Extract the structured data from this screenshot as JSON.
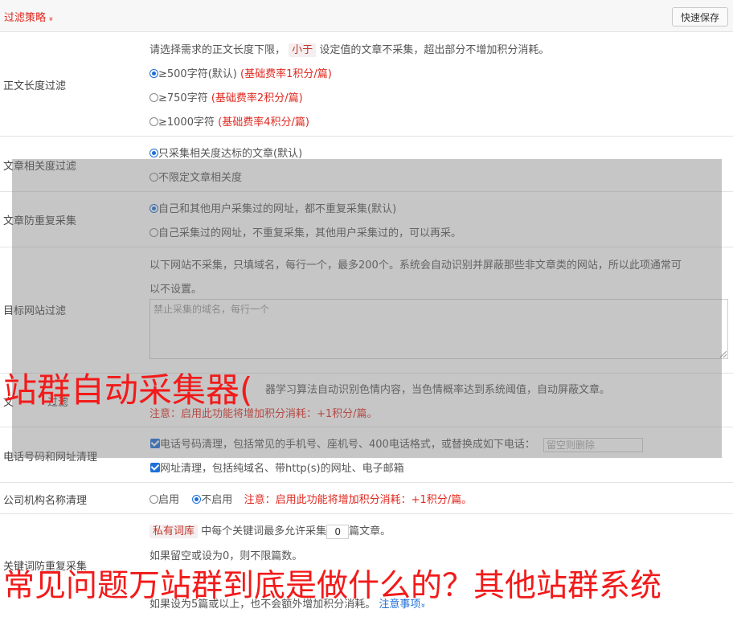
{
  "header": {
    "title": "过滤策略",
    "chevron": "»",
    "save_label": "快速保存"
  },
  "length_filter": {
    "label": "正文长度过滤",
    "desc_before": "请选择需求的正文长度下限，",
    "desc_tag": "小于",
    "desc_after": "设定值的文章不采集，超出部分不增加积分消耗。",
    "options": [
      {
        "text": "≥500字符(默认)",
        "note": "(基础费率1积分/篇)"
      },
      {
        "text": "≥750字符",
        "note": "(基础费率2积分/篇)"
      },
      {
        "text": "≥1000字符",
        "note": "(基础费率4积分/篇)"
      }
    ]
  },
  "relevance": {
    "label": "文章相关度过滤",
    "options": [
      "只采集相关度达标的文章(默认)",
      "不限定文章相关度"
    ]
  },
  "dedupe": {
    "label": "文章防重复采集",
    "options": [
      "自己和其他用户采集过的网址，都不重复采集(默认)",
      "自己采集过的网址，不重复采集，其他用户采集过的，可以再采。"
    ]
  },
  "site_filter": {
    "label": "目标网站过滤",
    "desc_line1": "以下网站不采集，只填域名，每行一个，最多200个。系统会自动识别并屏蔽那些非文章类的网站，所以此项通常可",
    "desc_line2": "以不设置。",
    "placeholder": "禁止采集的域名，每行一个"
  },
  "porn_filter": {
    "label_partial": "文",
    "label_partial2": "过滤",
    "text_partial": "器学习算法自动识别色情内容，当色情概率达到系统阈值，自动屏蔽文章。",
    "note": "注意：启用此功能将增加积分消耗：+1积分/篇。"
  },
  "phone_clean": {
    "label": "电话号码和网址清理",
    "phone_text": "电话号码清理，包括常见的手机号、座机号、400电话格式，或替换成如下电话：",
    "phone_placeholder": "留空则删除",
    "url_text": "网址清理，包括纯域名、带http(s)的网址、电子邮箱"
  },
  "org_clean": {
    "label": "公司机构名称清理",
    "enable": "启用",
    "disable": "不启用",
    "note": "注意：启用此功能将增加积分消耗：+1积分/篇。"
  },
  "keyword_dedupe": {
    "label": "关键词防重复采集",
    "tag": "私有词库",
    "line1_after": "中每个关键词最多允许采集",
    "count": "0",
    "line1_end": "篇文章。",
    "line2": "如果留空或设为0，则不限篇数。",
    "line4": "如果设为5篇或以上，也不会额外增加积分消耗。",
    "notice_link": "注意事项",
    "notice_chevron": "»"
  },
  "watermark": {
    "line1": "站群自动采集器(",
    "line2": "常见问题万站群到底是做什么的？其他站群系统"
  },
  "colors": {
    "accent_red": "#e0281f",
    "accent_blue": "#1e6fd9",
    "watermark_red": "#f21a1a"
  }
}
